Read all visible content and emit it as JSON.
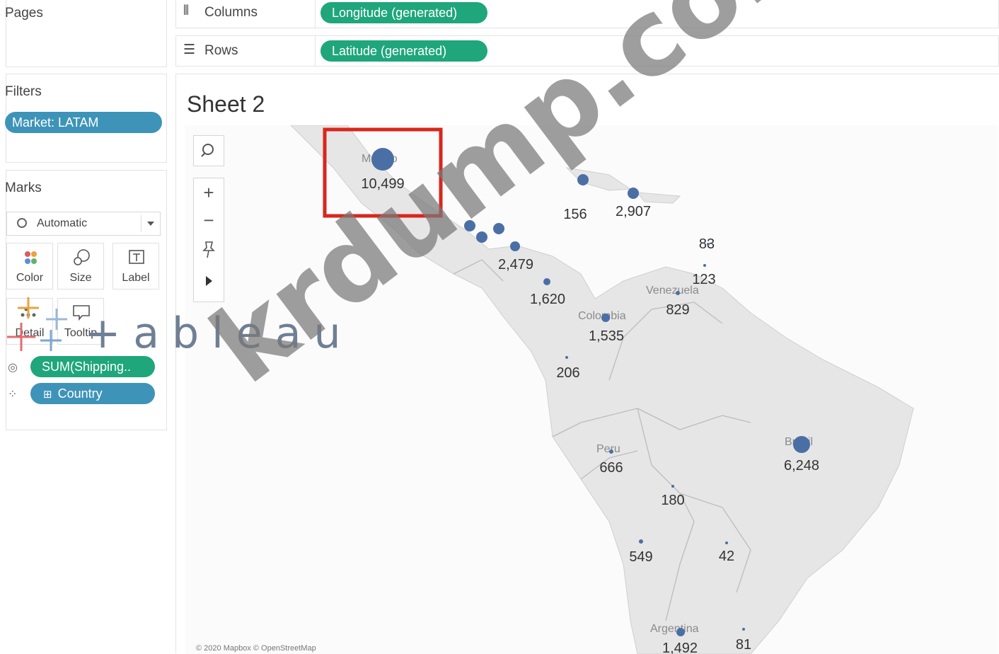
{
  "left_pane": {
    "pages_title": "Pages",
    "filters_title": "Filters",
    "filter_pill": "Market: LATAM",
    "marks_title": "Marks",
    "mark_type": "Automatic",
    "buttons": {
      "color": "Color",
      "size": "Size",
      "label": "Label",
      "detail": "Detail",
      "tooltip": "Tooltip"
    },
    "size_pill": "SUM(Shipping..",
    "detail_pill": "Country"
  },
  "shelves": {
    "columns_label": "Columns",
    "columns_pill": "Longitude (generated)",
    "rows_label": "Rows",
    "rows_pill": "Latitude (generated)"
  },
  "sheet": {
    "title": "Sheet 2",
    "credit": "© 2020 Mapbox © OpenStreetMap"
  },
  "map": {
    "country_labels": [
      "Mexico",
      "Venezuela",
      "Colombia",
      "Peru",
      "Brazil",
      "Argentina"
    ],
    "marks": [
      {
        "id": "mexico",
        "value": "10,499",
        "size": "large",
        "highlighted": true
      },
      {
        "id": "caribbean-1",
        "value": "156",
        "size": "small"
      },
      {
        "id": "caribbean-2",
        "value": "2,907",
        "size": "small"
      },
      {
        "id": "caribbean-3",
        "value": "83",
        "size": "tiny"
      },
      {
        "id": "caribbean-4",
        "value": "123",
        "size": "tiny"
      },
      {
        "id": "central-america",
        "value": "2,479",
        "size": "small"
      },
      {
        "id": "panama",
        "value": "1,620",
        "size": "small"
      },
      {
        "id": "venezuela",
        "value": "829",
        "size": "tiny"
      },
      {
        "id": "colombia",
        "value": "1,535",
        "size": "small"
      },
      {
        "id": "ecuador",
        "value": "206",
        "size": "tiny"
      },
      {
        "id": "peru",
        "value": "666",
        "size": "tiny"
      },
      {
        "id": "brazil",
        "value": "6,248",
        "size": "medium"
      },
      {
        "id": "bolivia",
        "value": "180",
        "size": "tiny"
      },
      {
        "id": "chile",
        "value": "549",
        "size": "tiny"
      },
      {
        "id": "paraguay",
        "value": "42",
        "size": "tiny"
      },
      {
        "id": "argentina",
        "value": "1,492",
        "size": "small"
      },
      {
        "id": "uruguay",
        "value": "81",
        "size": "tiny"
      }
    ],
    "mark_color": "#4a6fa5"
  },
  "watermarks": {
    "tableau": "+ableau",
    "krdump": "krdump.com"
  },
  "colors": {
    "blue_pill": "#3e93b8",
    "green_pill": "#1fa67a",
    "highlight": "#d9261c"
  }
}
